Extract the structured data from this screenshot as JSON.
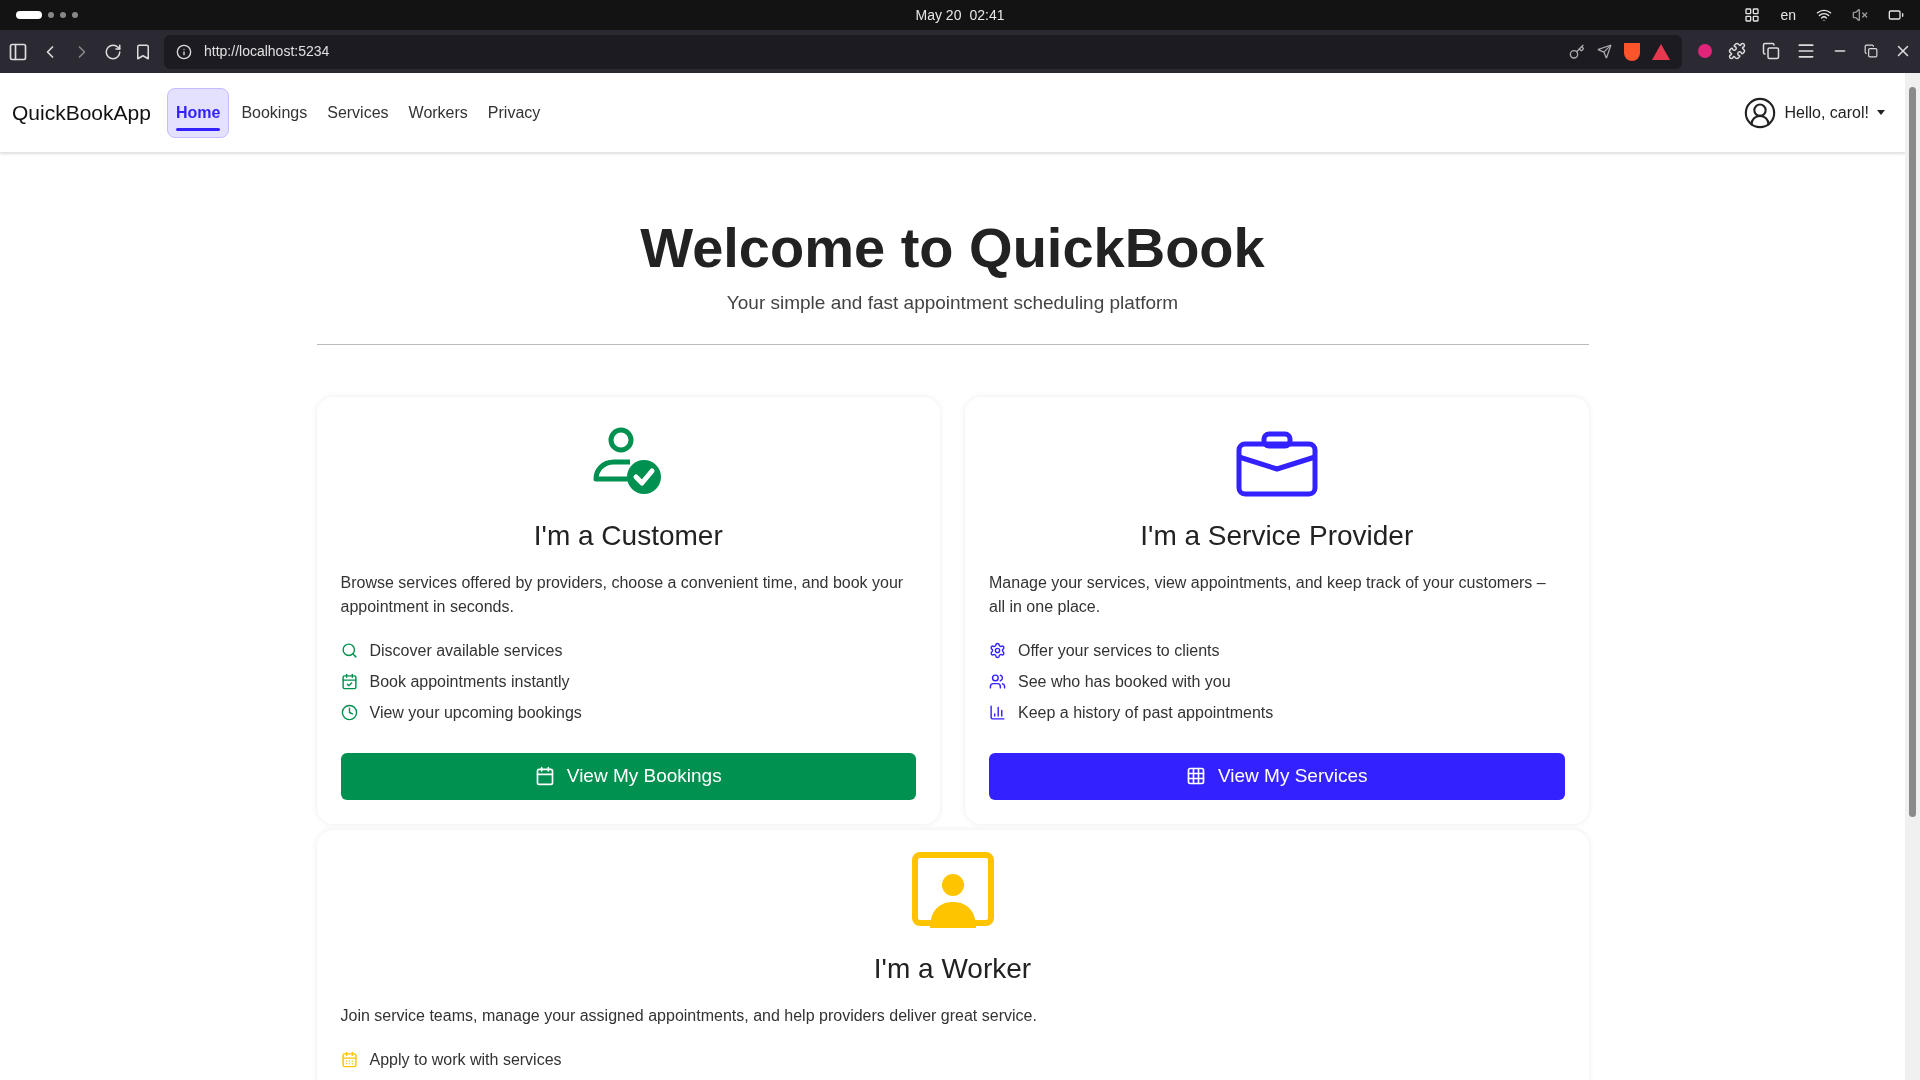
{
  "system_bar": {
    "date": "May 20",
    "time": "02:41",
    "language": "en"
  },
  "browser": {
    "url": "http://localhost:5234"
  },
  "navbar": {
    "brand": "QuickBookApp",
    "links": [
      {
        "label": "Home",
        "selected": true
      },
      {
        "label": "Bookings",
        "selected": false
      },
      {
        "label": "Services",
        "selected": false
      },
      {
        "label": "Workers",
        "selected": false
      },
      {
        "label": "Privacy",
        "selected": false
      }
    ],
    "user": {
      "greeting": "Hello, carol!"
    }
  },
  "hero": {
    "title": "Welcome to QuickBook",
    "subtitle": "Your simple and fast appointment scheduling platform"
  },
  "roles": [
    {
      "kind": "customer",
      "color": "#009150",
      "title": "I'm a Customer",
      "description": "Browse services offered by providers, choose a convenient time, and book your appointment in seconds.",
      "features": [
        "Discover available services",
        "Book appointments instantly",
        "View your upcoming bookings"
      ],
      "button": "View My Bookings"
    },
    {
      "kind": "provider",
      "color": "#3322ff",
      "title": "I'm a Service Provider",
      "description": "Manage your services, view appointments, and keep track of your customers – all in one place.",
      "features": [
        "Offer your services to clients",
        "See who has booked with you",
        "Keep a history of past appointments"
      ],
      "button": "View My Services"
    },
    {
      "kind": "worker",
      "color": "#ffc400",
      "title": "I'm a Worker",
      "description": "Join service teams, manage your assigned appointments, and help providers deliver great service.",
      "features": [
        "Apply to work with services"
      ]
    }
  ]
}
